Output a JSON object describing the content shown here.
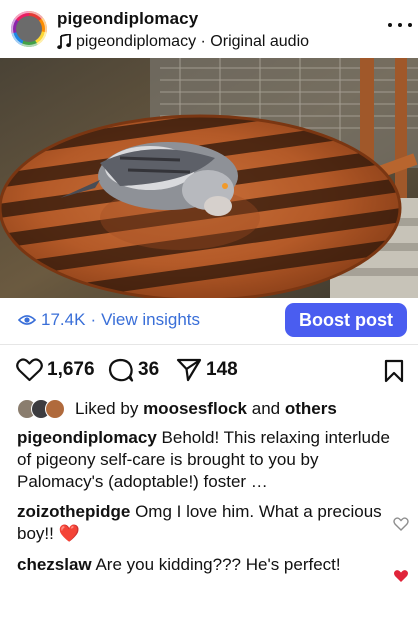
{
  "post": {
    "username": "pigeondiplomacy",
    "audio_label": "pigeondiplomacy · Original audio"
  },
  "insights": {
    "views": "17.4K",
    "separator": "·",
    "view_insights_label": "View insights",
    "boost_label": "Boost post"
  },
  "actions": {
    "likes": "1,676",
    "comments": "36",
    "shares": "148"
  },
  "liked_by": {
    "prefix": "Liked by",
    "user": "moosesflock",
    "and": "and",
    "others": "others"
  },
  "caption": {
    "username": "pigeondiplomacy",
    "text": "Behold! This relaxing interlude of pigeony self-care is brought to you by Palomacy's (adoptable!) foster …"
  },
  "comments": [
    {
      "username": "zoizothepidge",
      "text": "Omg I love him. What a precious boy!!",
      "emoji": "❤️",
      "liked": false
    },
    {
      "username": "chezslaw",
      "text": "Are you kidding??? He's perfect!",
      "liked": true
    }
  ],
  "colors": {
    "link_blue": "#3a6fd8",
    "boost_bg": "#4a5df0",
    "heart_red": "#e0243a"
  },
  "icons": {
    "more": "more-horizontal-icon",
    "music_note": "music-note-icon",
    "mute": "speaker-muted-icon",
    "views": "eye-icon",
    "like": "heart-outline-icon",
    "comment": "comment-bubble-icon",
    "share": "paper-plane-icon",
    "save": "bookmark-icon"
  }
}
